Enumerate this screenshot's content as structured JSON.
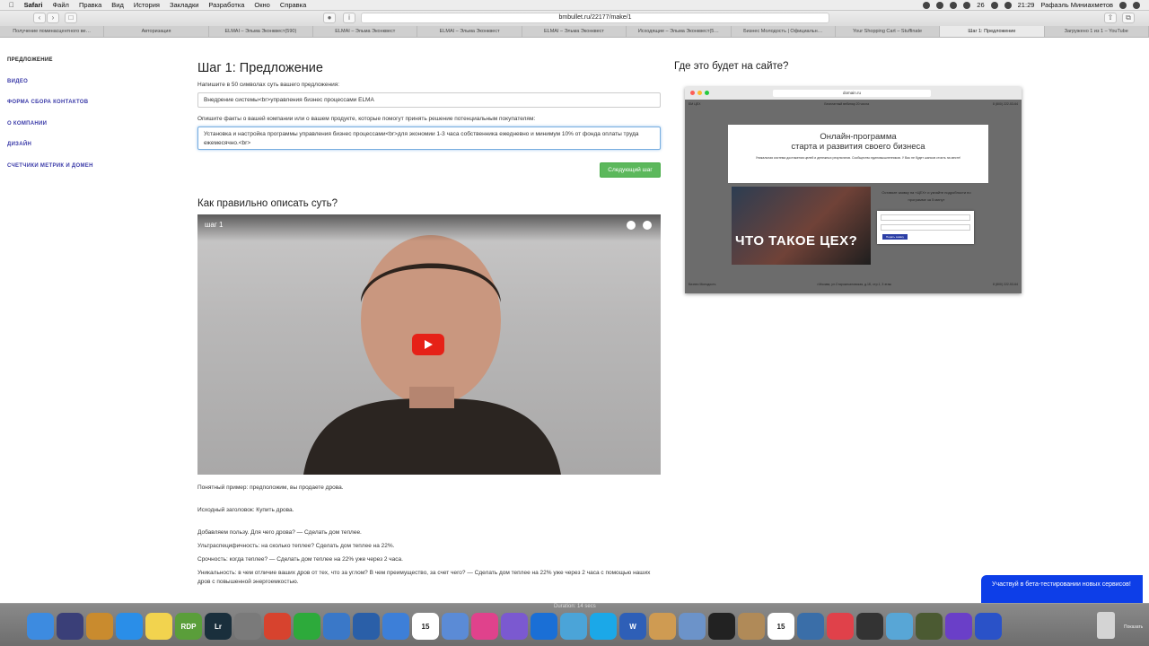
{
  "menubar": {
    "app_name": "Safari",
    "menus": [
      "Файл",
      "Правка",
      "Вид",
      "История",
      "Закладки",
      "Разработка",
      "Окно",
      "Справка"
    ],
    "clock": "21:29",
    "user": "Рафаэль Миниахметов",
    "battery": "26"
  },
  "browser": {
    "url": "bmbullet.ru/22177/make/1",
    "tabs": [
      {
        "label": "Получение поминасцентного ве…",
        "active": false
      },
      {
        "label": "Авторизация",
        "active": false
      },
      {
        "label": "ELMAI – Эльма Эконквест(590)",
        "active": false
      },
      {
        "label": "ELMAI – Эльма Эконквест",
        "active": false
      },
      {
        "label": "ELMAI – Эльма Эконквест",
        "active": false
      },
      {
        "label": "ELMAI – Эльма Эконквест",
        "active": false
      },
      {
        "label": "Исходящие – Эльма Эконквест(5…",
        "active": false
      },
      {
        "label": "Бизнес Молодость | Официальн…",
        "active": false
      },
      {
        "label": "Your Shopping Cart – Stuffinate",
        "active": false
      },
      {
        "label": "Шаг 1: Предложение",
        "active": true
      },
      {
        "label": "Загружено 1 из 1 – YouTube",
        "active": false
      }
    ]
  },
  "sidenav": {
    "items": [
      {
        "label": "Предложение",
        "active": true
      },
      {
        "label": "Видео",
        "active": false
      },
      {
        "label": "Форма сбора контактов",
        "active": false
      },
      {
        "label": "О компании",
        "active": false
      },
      {
        "label": "Дизайн",
        "active": false
      },
      {
        "label": "Счетчики метрик и домен",
        "active": false
      }
    ]
  },
  "main": {
    "title": "Шаг 1: Предложение",
    "offer_label": "Напишите в 50 символах суть вашего предложения:",
    "offer_value": "Внедрение системы<br>управления бизнес процессами ELMA",
    "facts_label": "Опишите факты о вашей компании или о вашем продукте, которые помогут принять решение потенциальным покупателям:",
    "facts_value": "Установка и настройка программы управления бизнес процессами<br>для экономии 1-3 часа собственника ежедневно и минимум 10% от фонда оплаты труда ежемесячно.<br>",
    "next_button": "Следующий шаг",
    "howto_title": "Как правильно описать суть?",
    "video_title": "шаг 1",
    "examples": [
      "Понятный пример: предположим, вы продаете дрова.",
      "Исходный заголовок: Купить дрова.",
      "Добавляем пользу. Для чего дрова? — Сделать дом теплее.",
      "Ультраспецифичность: на сколько теплее? Сделать дом теплее на 22%.",
      "Срочность: когда теплее? — Сделать дом теплее на 22% уже через 2 часа.",
      "Уникальность: в чем отличие ваших дров от тех, что за углом? В чем преимущество, за счет чего? — Сделать дом теплее на 22% уже через 2 часа с помощью наших дров с повышенной энергоемкостью."
    ]
  },
  "preview": {
    "title": "Где это будет на сайте?",
    "url": "domain.ru",
    "nav_left": "БМ ЦЕХ",
    "nav_mid": "Бесплатный вебинар 20 числа",
    "nav_phone": "8 (800) 222-53-64",
    "hero_line1": "Онлайн-программа",
    "hero_line2": "старта и развития своего бизнеса",
    "hero_small": "Уникальная система достижения целей и денежных результатов. Сообщество единомышленников. У Вас не будет шансов стоять на месте!",
    "video_caption": "ЧТО ТАКОЕ ЦЕХ?",
    "side_text": "Оставьте заявку на «ЦЕХ» и узнайте подробности по программе за 5 минут",
    "form_button": "Подать заявку",
    "footer_left": "Бизнес Молодость",
    "footer_mid": "г.Москва, ул.Старокачаловская, д.1Б, стр.1, 3 этаж",
    "footer_phone": "8 (800) 222-53-64"
  },
  "banner": {
    "text": "Участвуй в бета-тестировании новых сервисов!"
  },
  "dock": {
    "duration": "Duration: 14 secs",
    "calendar_day": "15",
    "trash_label": "Показать",
    "apps": [
      {
        "name": "finder-icon",
        "label": "",
        "color": "#3d8be0"
      },
      {
        "name": "siri-icon",
        "label": "",
        "color": "#3a3f78"
      },
      {
        "name": "launchpad-icon",
        "label": "",
        "color": "#c98b2e"
      },
      {
        "name": "safari-icon",
        "label": "",
        "color": "#2a8ee8"
      },
      {
        "name": "notes-icon",
        "label": "",
        "color": "#f2d34e"
      },
      {
        "name": "rdp-icon",
        "label": "RDP",
        "color": "#5a9e3a"
      },
      {
        "name": "lightroom-icon",
        "label": "Lr",
        "color": "#1a2f3c"
      },
      {
        "name": "system-preferences-icon",
        "label": "",
        "color": "#7a7a7a"
      },
      {
        "name": "todoist-icon",
        "label": "",
        "color": "#d7432e"
      },
      {
        "name": "evernote-icon",
        "label": "",
        "color": "#2daa3b"
      },
      {
        "name": "things-icon",
        "label": "",
        "color": "#3a78c8"
      },
      {
        "name": "1password-icon",
        "label": "",
        "color": "#2a5fa8"
      },
      {
        "name": "messages-icon",
        "label": "",
        "color": "#3d7fd8"
      },
      {
        "name": "calendar-icon",
        "label": "15",
        "color": "#ffffff"
      },
      {
        "name": "xcode-icon",
        "label": "",
        "color": "#5b8bd6"
      },
      {
        "name": "itunes-icon",
        "label": "",
        "color": "#e0428c"
      },
      {
        "name": "viber-icon",
        "label": "",
        "color": "#7b59d0"
      },
      {
        "name": "teamviewer-icon",
        "label": "",
        "color": "#1a6fd6"
      },
      {
        "name": "archive-utility-icon",
        "label": "",
        "color": "#4ba4d8"
      },
      {
        "name": "skype-icon",
        "label": "",
        "color": "#1ba8e8"
      },
      {
        "name": "word-icon",
        "label": "W",
        "color": "#2e5fb7"
      },
      {
        "name": "preview-icon",
        "label": "",
        "color": "#cf9b52"
      },
      {
        "name": "network-utility-icon",
        "label": "",
        "color": "#6c93c9"
      },
      {
        "name": "activity-monitor-icon",
        "label": "",
        "color": "#222222"
      },
      {
        "name": "archive-icon",
        "label": "",
        "color": "#b08a58"
      },
      {
        "name": "calendar-2-icon",
        "label": "15",
        "color": "#ffffff"
      },
      {
        "name": "quicktime-icon",
        "label": "",
        "color": "#3a6ea8"
      },
      {
        "name": "red-app-icon",
        "label": "",
        "color": "#e0414a"
      },
      {
        "name": "screen-icon",
        "label": "",
        "color": "#333333"
      },
      {
        "name": "transmit-icon",
        "label": "",
        "color": "#58a6d6"
      },
      {
        "name": "radar-icon",
        "label": "",
        "color": "#4b5a32"
      },
      {
        "name": "imovie-icon",
        "label": "",
        "color": "#6a3fc8"
      },
      {
        "name": "screenflow-icon",
        "label": "",
        "color": "#2a52c8"
      }
    ]
  }
}
